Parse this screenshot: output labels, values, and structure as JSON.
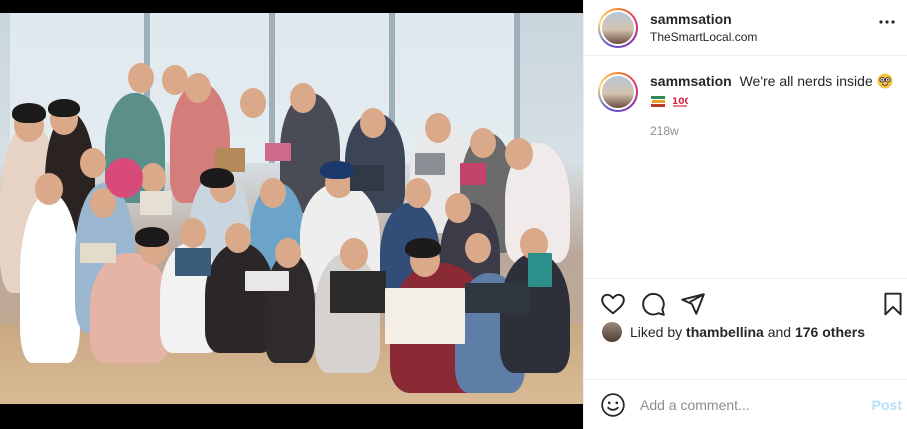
{
  "post": {
    "username": "sammsation",
    "location": "TheSmartLocal.com",
    "more_icon": "more-horizontal-icon"
  },
  "caption": {
    "username": "sammsation",
    "text": "We're all nerds inside",
    "emojis": [
      "nerd-face-emoji",
      "books-emoji",
      "hundred-points-emoji"
    ],
    "time": "218w"
  },
  "actions": {
    "icons": [
      "heart-icon",
      "comment-icon",
      "share-icon",
      "bookmark-icon"
    ]
  },
  "likes": {
    "prefix": "Liked by",
    "user": "thambellina",
    "connector": "and",
    "others": "176 others"
  },
  "comment": {
    "placeholder": "Add a comment...",
    "post_label": "Post"
  },
  "colors": {
    "accent": "#0095f6",
    "post_disabled": "#b2dffc",
    "text": "#262626",
    "muted": "#8e8e8e",
    "divider": "#efefef"
  }
}
